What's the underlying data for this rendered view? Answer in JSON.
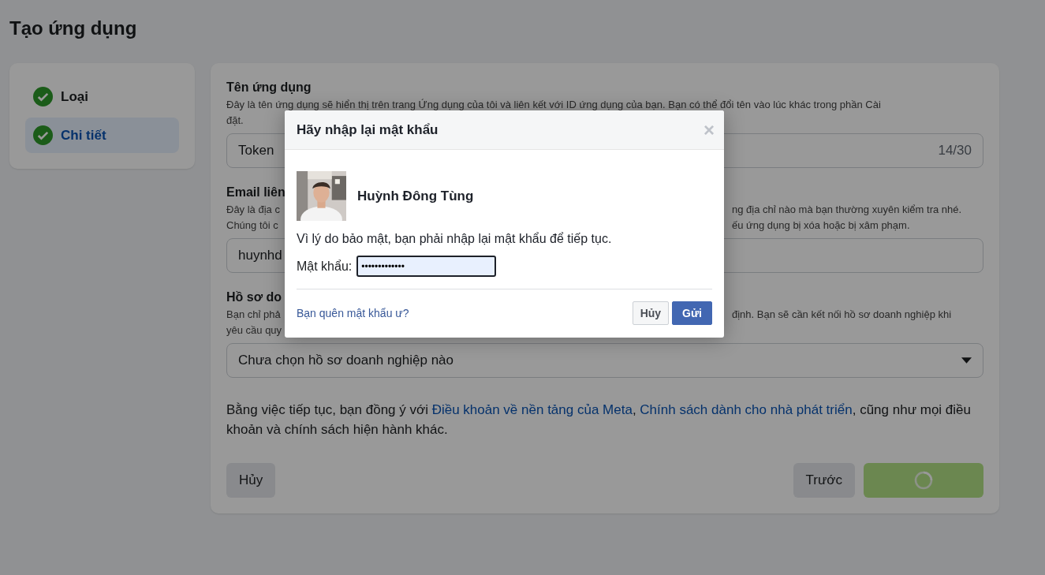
{
  "page_title": "Tạo ứng dụng",
  "steps": [
    {
      "label": "Loại",
      "completed": true,
      "selected": false
    },
    {
      "label": "Chi tiết",
      "completed": true,
      "selected": true
    }
  ],
  "form": {
    "app_name": {
      "label": "Tên ứng dụng",
      "description": [
        "Đây là tên ứng dụng sẽ hiển thị trên trang Ứng dụng của tôi và liên kết với ID ứng dụng của bạn. Bạn có thể đổi tên vào lúc khác trong phần Cài",
        "đặt."
      ],
      "value": "Token",
      "counter": "14/30"
    },
    "email": {
      "label": "Email liên",
      "description": [
        [
          "Đây là địa c",
          "ng địa chỉ nào mà bạn thường xuyên kiểm tra nhé."
        ],
        [
          "Chúng tôi c",
          "ếu ứng dụng bị xóa hoặc bị xâm phạm."
        ]
      ],
      "value": "huynhd"
    },
    "business": {
      "label": "Hồ sơ do",
      "description": [
        [
          "Bạn chỉ phả",
          "định. Bạn sẽ cần kết nối hồ sơ doanh nghiệp khi"
        ],
        [
          "yêu cầu quy"
        ]
      ],
      "value": "Chưa chọn hồ sơ doanh nghiệp nào"
    },
    "terms": [
      {
        "kind": "text",
        "text": "Bằng việc tiếp tục, bạn đồng ý với "
      },
      {
        "kind": "link",
        "text": "Điều khoản về nền tảng của Meta"
      },
      {
        "kind": "text",
        "text": ", "
      },
      {
        "kind": "link",
        "text": "Chính sách dành cho nhà phát triển"
      },
      {
        "kind": "text",
        "text": ", cũng như mọi điều khoản và chính sách hiện hành khác."
      }
    ],
    "cancel_button": "Hủy",
    "previous_button": "Trước",
    "next_button": {
      "disabled": true
    }
  },
  "dialog": {
    "title": "Hãy nhập lại mật khẩu",
    "close": "×",
    "user_name": "Huỳnh Đông Tùng",
    "message": "Vì lý do bảo mật, bạn phải nhập lại mật khẩu để tiếp tục.",
    "password_label": "Mật khẩu:",
    "password_value": "•••••••••••••",
    "forgot_link": "Bạn quên mật khẩu ư?",
    "cancel_button": "Hủy",
    "submit_button": "Gửi"
  }
}
